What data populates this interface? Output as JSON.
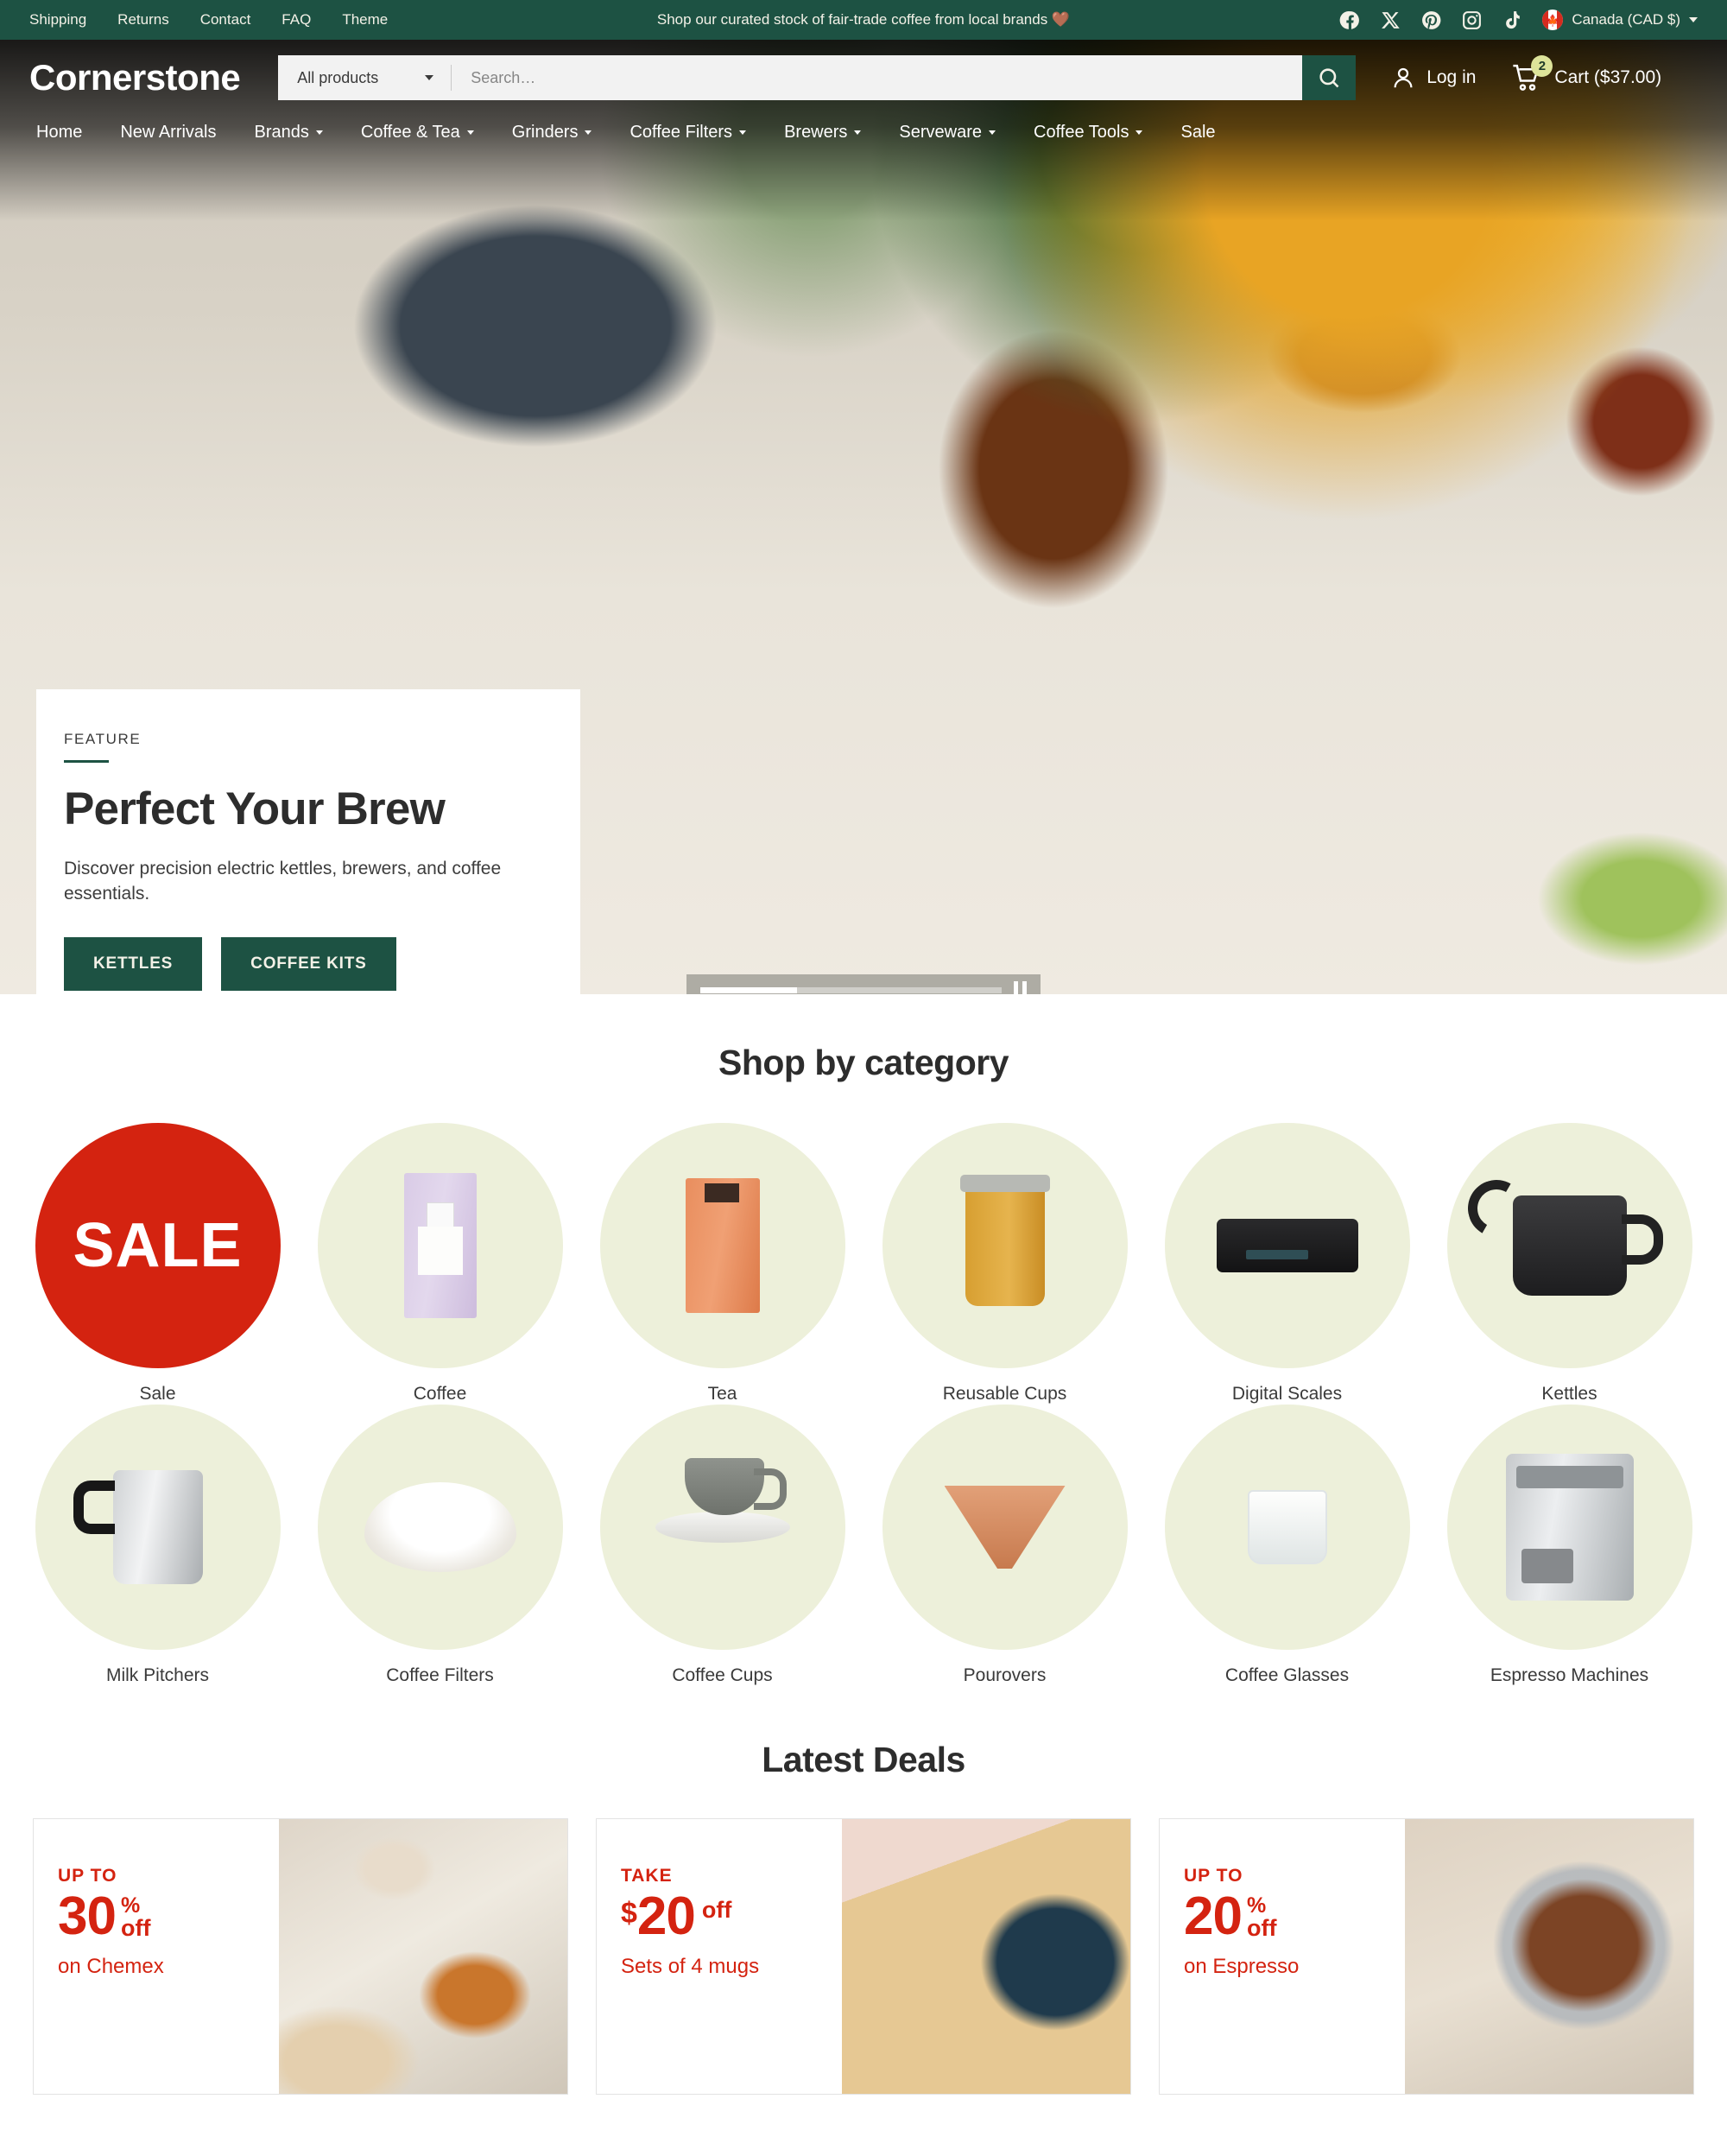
{
  "announcement": {
    "links": [
      "Shipping",
      "Returns",
      "Contact",
      "FAQ",
      "Theme"
    ],
    "message": "Shop our curated stock of fair-trade coffee from local brands 🤎",
    "social": [
      "facebook-icon",
      "x-icon",
      "pinterest-icon",
      "instagram-icon",
      "tiktok-icon"
    ],
    "locale": "Canada (CAD $)"
  },
  "header": {
    "logo": "Cornerstone",
    "search_scope": "All products",
    "search_placeholder": "Search…",
    "search_value": "",
    "login_label": "Log in",
    "cart_label": "Cart ($37.00)",
    "cart_count": "2"
  },
  "nav": [
    {
      "label": "Home",
      "caret": false
    },
    {
      "label": "New Arrivals",
      "caret": false
    },
    {
      "label": "Brands",
      "caret": true
    },
    {
      "label": "Coffee & Tea",
      "caret": true
    },
    {
      "label": "Grinders",
      "caret": true
    },
    {
      "label": "Coffee Filters",
      "caret": true
    },
    {
      "label": "Brewers",
      "caret": true
    },
    {
      "label": "Serveware",
      "caret": true
    },
    {
      "label": "Coffee Tools",
      "caret": true
    },
    {
      "label": "Sale",
      "caret": false
    }
  ],
  "hero": {
    "eyebrow": "FEATURE",
    "title": "Perfect Your Brew",
    "subtitle": "Discover precision electric kettles, brewers, and coffee essentials.",
    "button_primary": "KETTLES",
    "button_secondary": "COFFEE KITS",
    "carousel_progress": "32",
    "carousel_state": "pause-icon"
  },
  "categories": {
    "title": "Shop by category",
    "items": [
      {
        "label": "Sale",
        "art": "sale-badge",
        "badge_text": "SALE"
      },
      {
        "label": "Coffee",
        "art": "coffee-bag"
      },
      {
        "label": "Tea",
        "art": "tea-bag"
      },
      {
        "label": "Reusable Cups",
        "art": "reusable-cup"
      },
      {
        "label": "Digital Scales",
        "art": "digital-scale"
      },
      {
        "label": "Kettles",
        "art": "gooseneck-kettle"
      },
      {
        "label": "Milk Pitchers",
        "art": "milk-pitcher"
      },
      {
        "label": "Coffee Filters",
        "art": "paper-filter"
      },
      {
        "label": "Coffee Cups",
        "art": "cup-and-saucer"
      },
      {
        "label": "Pourovers",
        "art": "pourover-dripper"
      },
      {
        "label": "Coffee Glasses",
        "art": "glass-tumbler"
      },
      {
        "label": "Espresso Machines",
        "art": "espresso-machine"
      }
    ]
  },
  "deals": {
    "title": "Latest Deals",
    "cards": [
      {
        "kicker": "UP TO",
        "currency": "",
        "amount": "30",
        "percent": "%",
        "off": "off",
        "inline_off": false,
        "desc": "on Chemex",
        "image": "chemex-photo"
      },
      {
        "kicker": "TAKE",
        "currency": "$",
        "amount": "20",
        "percent": "",
        "off": "off",
        "inline_off": true,
        "desc": "Sets of 4 mugs",
        "image": "blue-mug-photo"
      },
      {
        "kicker": "UP TO",
        "currency": "",
        "amount": "20",
        "percent": "%",
        "off": "off",
        "inline_off": false,
        "desc": "on Espresso",
        "image": "portafilter-photo"
      }
    ]
  },
  "colors": {
    "brand_green": "#1d5243",
    "sale_red": "#d42310",
    "category_circle": "#edf0da",
    "badge": "#dde49a"
  }
}
